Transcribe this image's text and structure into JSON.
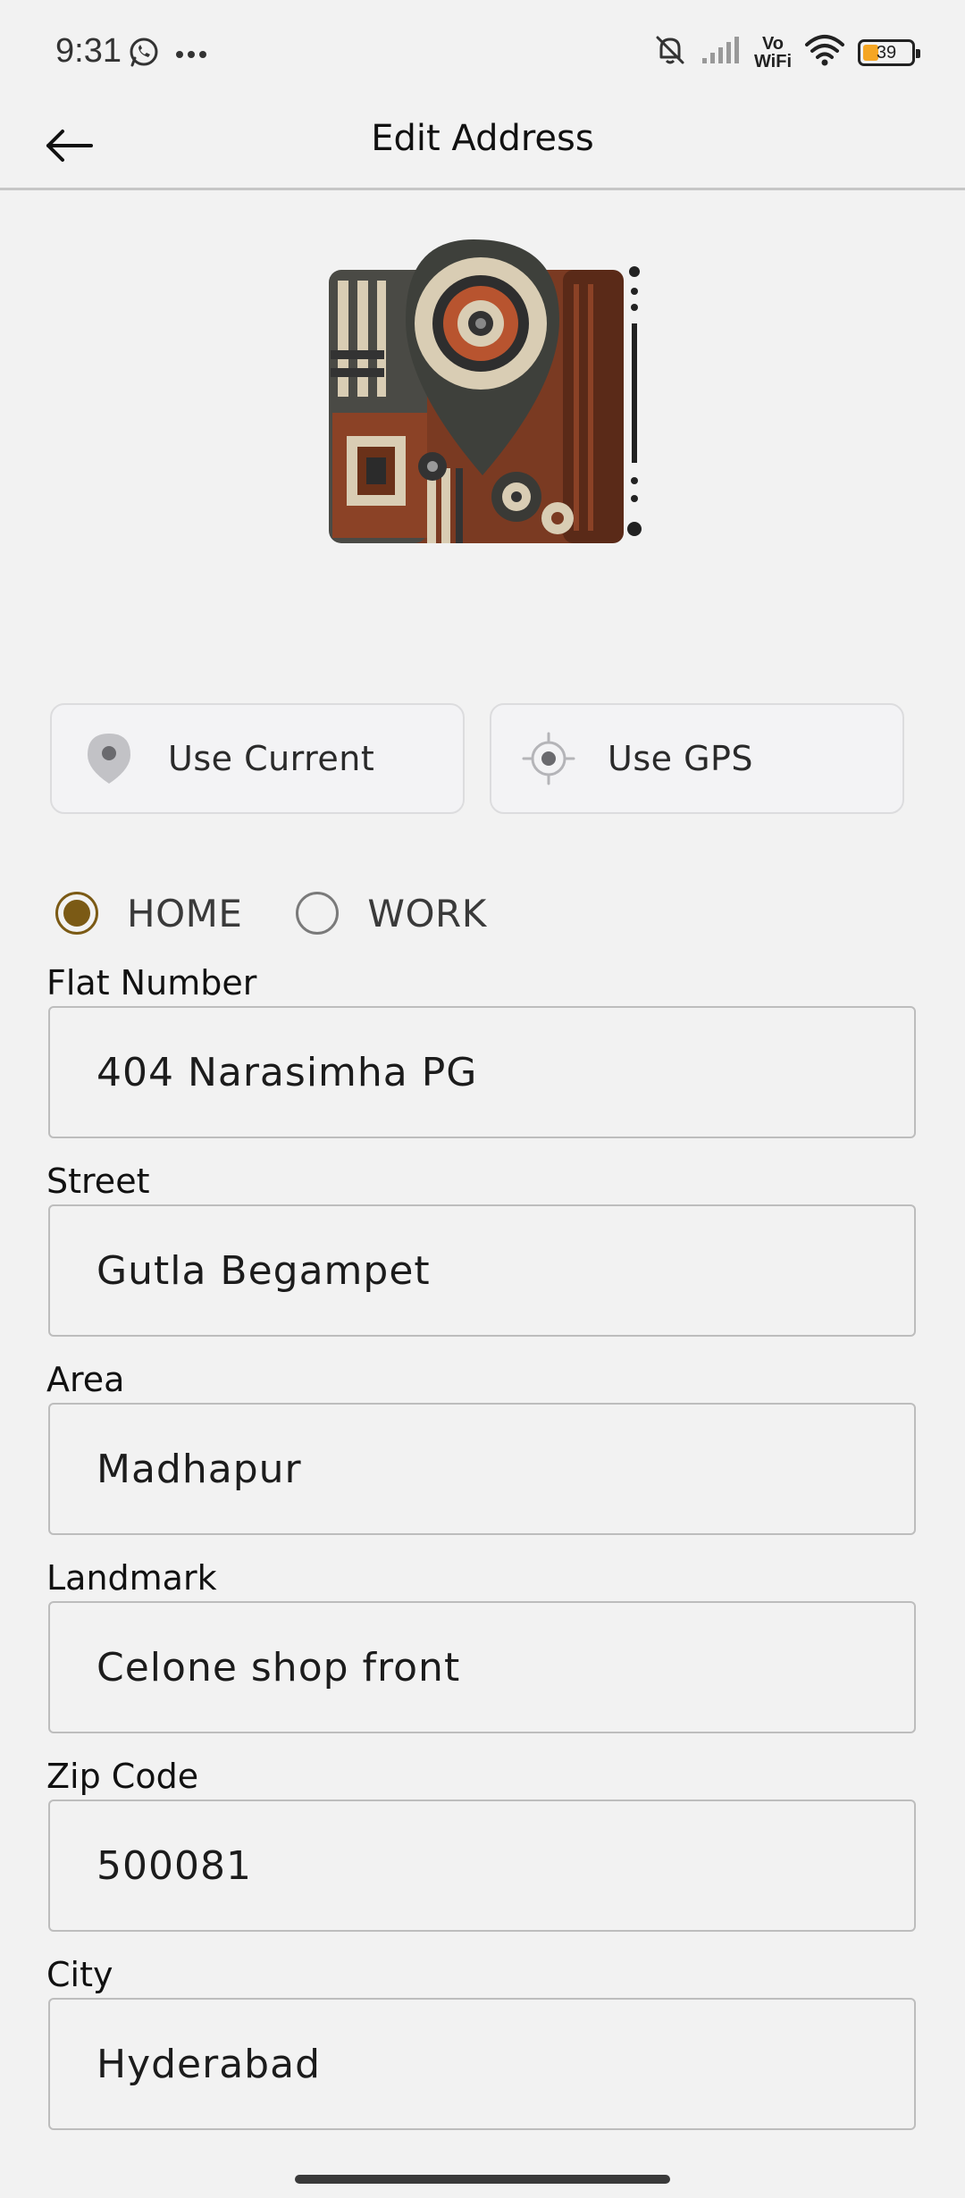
{
  "status_bar": {
    "time": "9:31",
    "left_icons": [
      "whatsapp-icon",
      "more-dots-icon"
    ],
    "right_icons": [
      "bell-muted-icon",
      "signal-icon",
      "vowifi-icon",
      "wifi-icon",
      "battery-icon"
    ],
    "vowifi_top": "Vo",
    "vowifi_bottom": "WiFi",
    "battery_percent": "39",
    "battery_level": 0.39,
    "battery_color": "#f5a623"
  },
  "app_bar": {
    "title": "Edit Address",
    "back_icon": "arrow-left-icon"
  },
  "location_buttons": {
    "current_label": "Use Current",
    "current_icon": "map-pin-icon",
    "gps_label": "Use GPS",
    "gps_icon": "crosshair-icon"
  },
  "address_type": {
    "options": [
      "HOME",
      "WORK"
    ],
    "selected": "HOME",
    "accent_color": "#7b5a15"
  },
  "form": {
    "fields": [
      {
        "label": "Flat Number",
        "value": "404 Narasimha PG"
      },
      {
        "label": "Street",
        "value": "Gutla Begampet"
      },
      {
        "label": "Area",
        "value": "Madhapur"
      },
      {
        "label": "Landmark",
        "value": "Celone shop front"
      },
      {
        "label": "Zip Code",
        "value": "500081"
      },
      {
        "label": "City",
        "value": "Hyderabad"
      }
    ]
  }
}
